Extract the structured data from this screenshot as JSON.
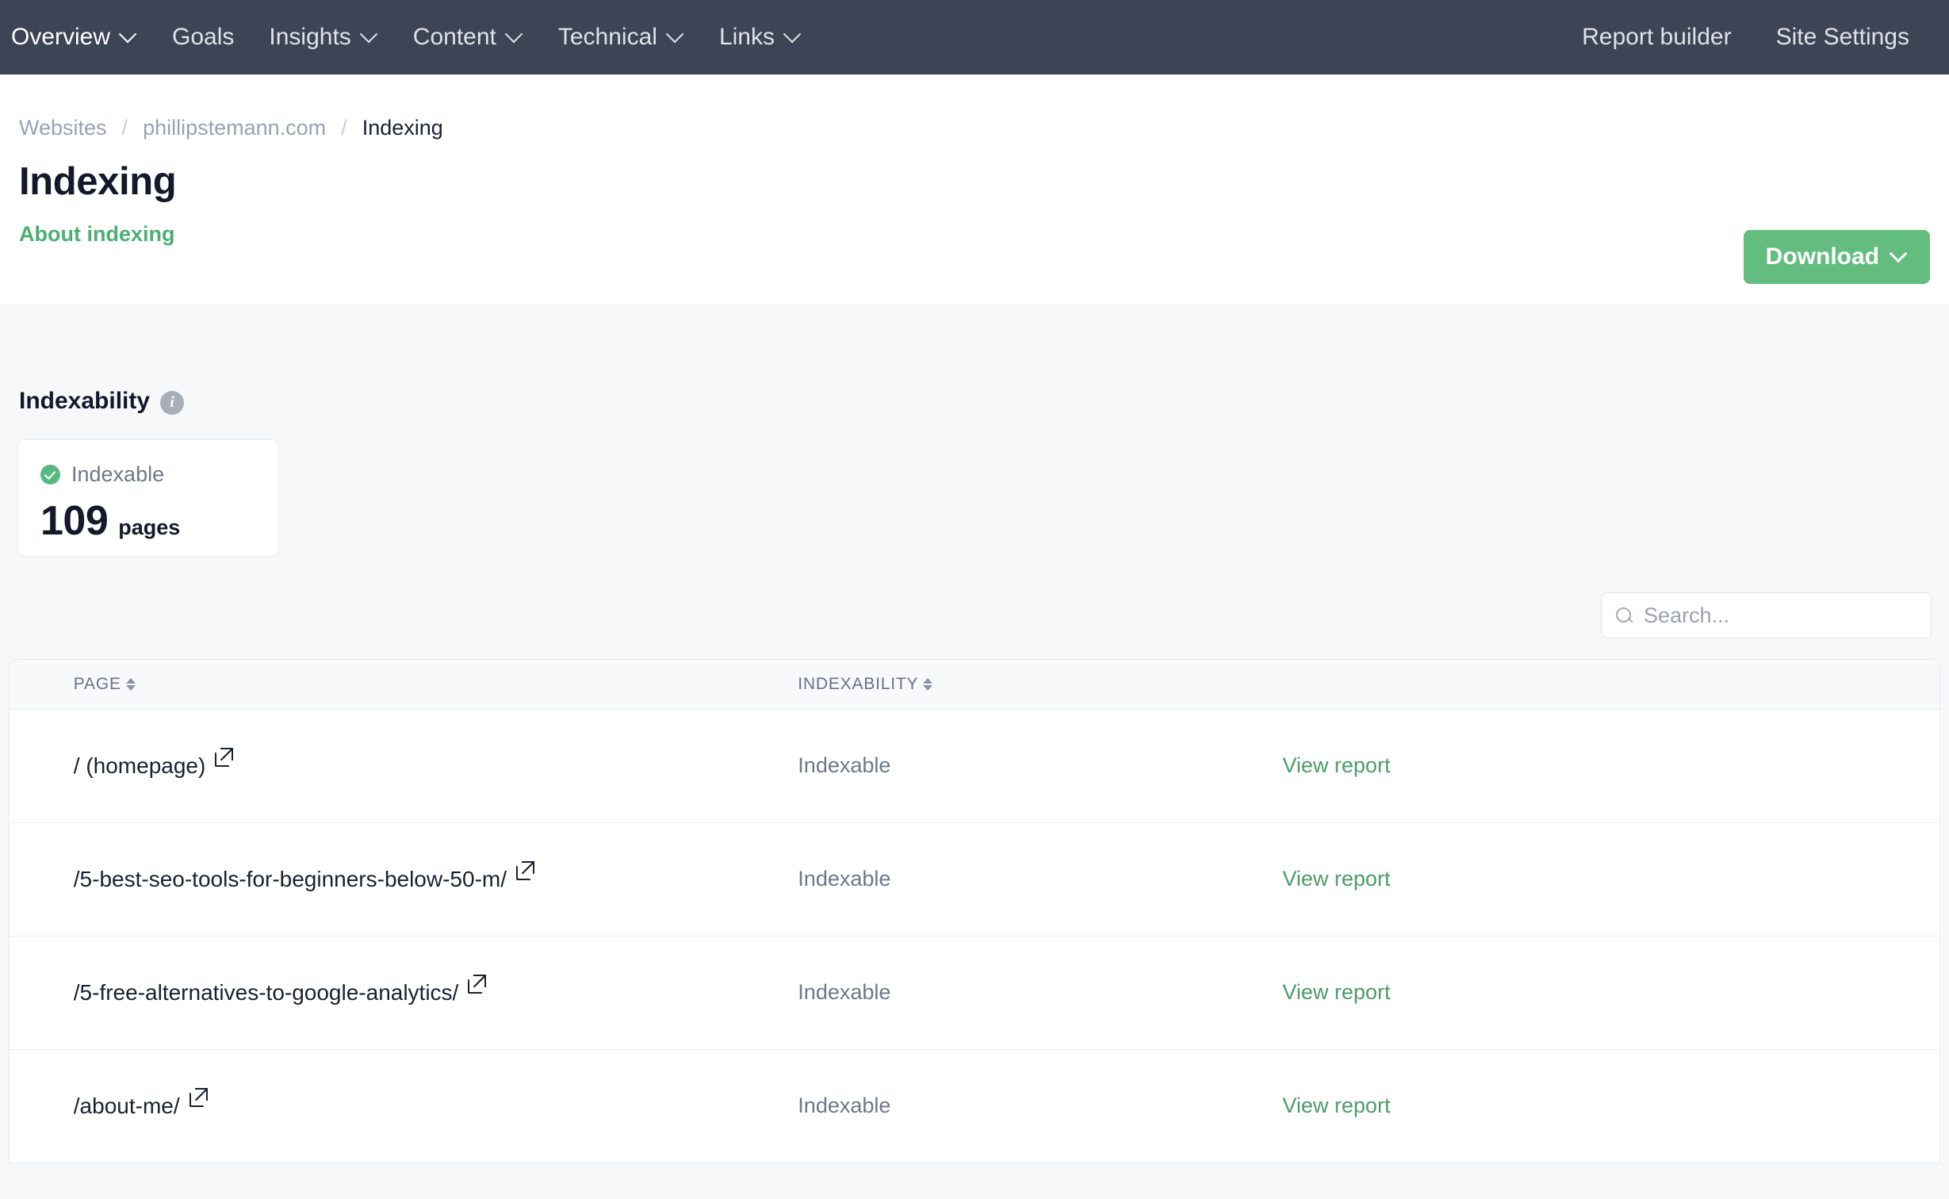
{
  "nav": {
    "left_items": [
      {
        "label": "Overview",
        "has_caret": true
      },
      {
        "label": "Goals",
        "has_caret": false
      },
      {
        "label": "Insights",
        "has_caret": true
      },
      {
        "label": "Content",
        "has_caret": true
      },
      {
        "label": "Technical",
        "has_caret": true
      },
      {
        "label": "Links",
        "has_caret": true
      }
    ],
    "right_items": [
      {
        "label": "Report builder"
      },
      {
        "label": "Site Settings"
      }
    ]
  },
  "breadcrumb": {
    "root": "Websites",
    "separator": "/",
    "site": "phillipstemann.com",
    "current": "Indexing"
  },
  "header": {
    "title": "Indexing",
    "about_link": "About indexing",
    "download_label": "Download"
  },
  "indexability": {
    "section_title": "Indexability",
    "info_glyph": "i",
    "card": {
      "status": "Indexable",
      "value": "109",
      "unit": "pages"
    }
  },
  "search": {
    "placeholder": "Search...",
    "value": ""
  },
  "table": {
    "columns": [
      {
        "key": "check",
        "label": ""
      },
      {
        "key": "page",
        "label": "PAGE",
        "sortable": true
      },
      {
        "key": "indexability",
        "label": "INDEXABILITY",
        "sortable": true
      },
      {
        "key": "action",
        "label": ""
      }
    ],
    "rows": [
      {
        "status": "ok",
        "page": "/ (homepage)",
        "indexability": "Indexable",
        "action": "View report"
      },
      {
        "status": "ok",
        "page": "/5-best-seo-tools-for-beginners-below-50-m/",
        "indexability": "Indexable",
        "action": "View report"
      },
      {
        "status": "ok",
        "page": "/5-free-alternatives-to-google-analytics/",
        "indexability": "Indexable",
        "action": "View report"
      },
      {
        "status": "ok",
        "page": "/about-me/",
        "indexability": "Indexable",
        "action": "View report"
      }
    ]
  },
  "colors": {
    "nav_bg": "#3d4455",
    "accent_green": "#63bd7f",
    "link_green": "#4b9b68",
    "status_green": "#56b97d",
    "page_bg": "#f7f8fa",
    "text_dark": "#13182a",
    "text_muted": "#6f7787"
  }
}
